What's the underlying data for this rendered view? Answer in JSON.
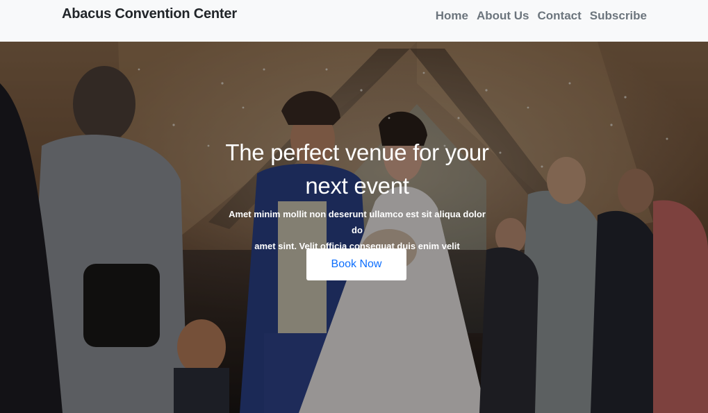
{
  "navbar": {
    "brand": "Abacus Convention Center",
    "links": [
      "Home",
      "About Us",
      "Contact",
      "Subscribe"
    ]
  },
  "hero": {
    "title_line1": "The perfect venue for your",
    "title_line2": "next event",
    "subtitle_line1": "Amet minim mollit non deserunt ullamco est sit aliqua dolor do",
    "subtitle_line2": "amet sint. Velit officia consequat duis enim velit",
    "button_label": "Book Now",
    "background_image": "wedding-photo"
  },
  "colors": {
    "navbar_bg": "#f8f9fa",
    "brand_text": "#212529",
    "nav_link": "#6c757d",
    "button_text": "#0d6efd",
    "button_bg": "#ffffff"
  }
}
